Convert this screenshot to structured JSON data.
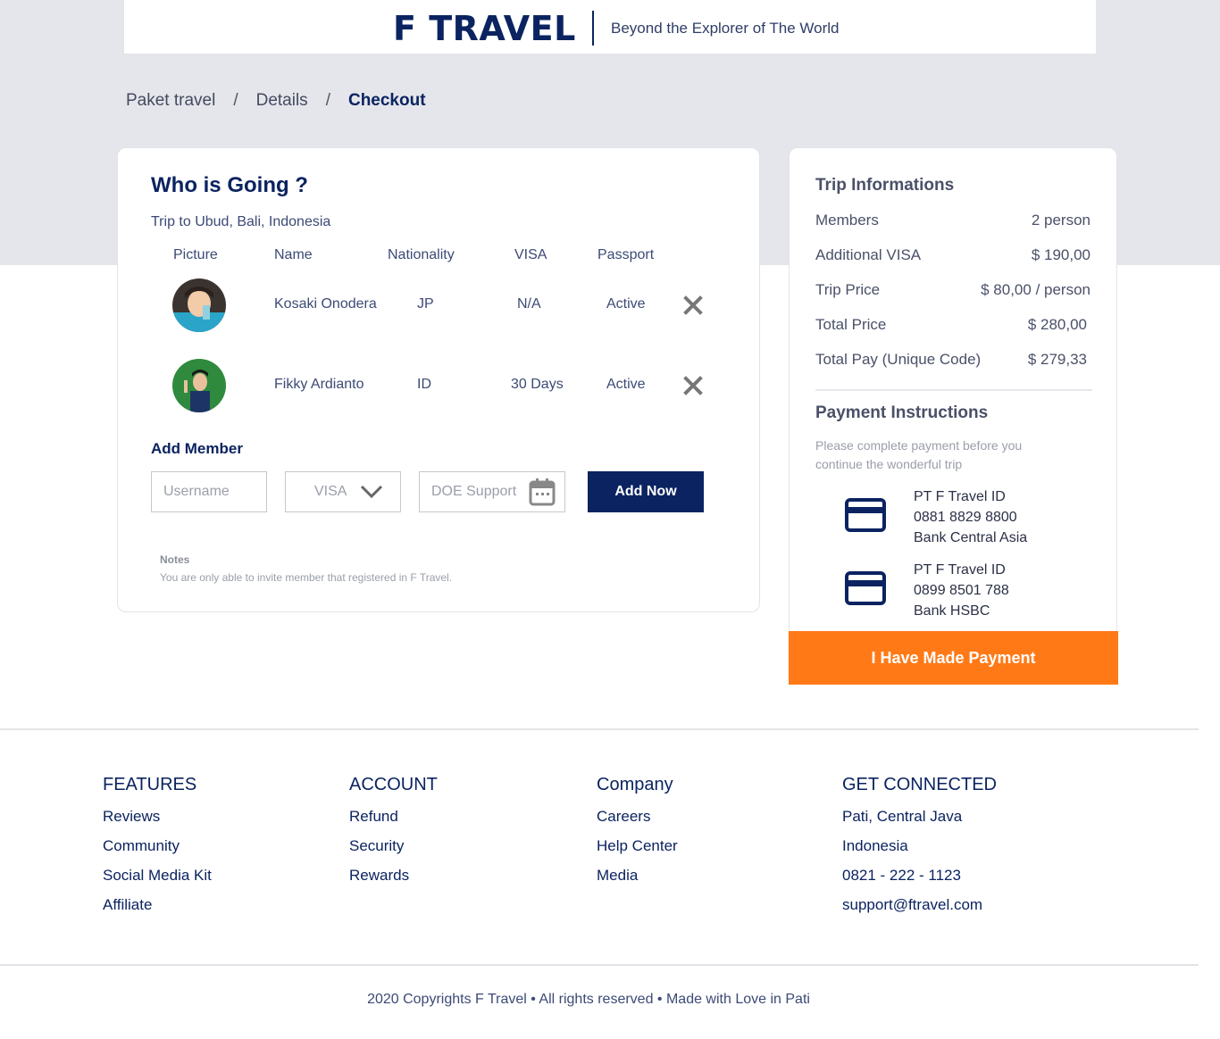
{
  "header": {
    "brand": "F TRAVEL",
    "tagline": "Beyond the Explorer of The World"
  },
  "breadcrumb": [
    {
      "label": "Paket travel"
    },
    {
      "label": "Details"
    },
    {
      "label": "Checkout"
    }
  ],
  "members_card": {
    "title": "Who is Going ?",
    "subtitle": "Trip to Ubud, Bali, Indonesia",
    "columns": [
      "Picture",
      "Name",
      "Nationality",
      "VISA",
      "Passport"
    ],
    "rows": [
      {
        "name": "Kosaki Onodera",
        "nationality": "JP",
        "visa": "N/A",
        "passport": "Active"
      },
      {
        "name": "Fikky Ardianto",
        "nationality": "ID",
        "visa": "30 Days",
        "passport": "Active"
      }
    ],
    "add_member_title": "Add Member",
    "username_placeholder": "Username",
    "visa_select": "VISA",
    "doe_placeholder": "DOE Support",
    "add_button": "Add Now",
    "notes_title": "Notes",
    "notes_text": "You are only able to invite member that registered in F Travel."
  },
  "trip_info": {
    "title": "Trip Informations",
    "rows": [
      {
        "label": "Members",
        "value": "2 person"
      },
      {
        "label": "Additional VISA",
        "value": "$ 190,00"
      },
      {
        "label": "Trip Price",
        "value": "$ 80,00 / person"
      },
      {
        "label": "Total Price",
        "value": "$ 280,00"
      },
      {
        "label": "Total Pay (Unique Code)",
        "value": "$ 279,33"
      }
    ],
    "payment_title": "Payment Instructions",
    "payment_desc": "Please complete payment before you continue the wonderful trip",
    "banks": [
      {
        "name": "PT F Travel ID",
        "account": "0881 8829 8800",
        "bank": "Bank Central Asia"
      },
      {
        "name": "PT F Travel ID",
        "account": "0899 8501 788",
        "bank": "Bank HSBC"
      }
    ],
    "pay_button": "I Have Made Payment"
  },
  "footer": {
    "columns": [
      {
        "title": "FEATURES",
        "links": [
          "Reviews",
          "Community",
          "Social Media Kit",
          "Affiliate"
        ]
      },
      {
        "title": "ACCOUNT",
        "links": [
          "Refund",
          "Security",
          "Rewards"
        ]
      },
      {
        "title": "Company",
        "links": [
          "Careers",
          "Help Center",
          "Media"
        ]
      },
      {
        "title": "GET CONNECTED",
        "links": [
          "Pati, Central Java",
          "Indonesia",
          "0821 - 222 - 1123",
          "support@ftravel.com"
        ]
      }
    ],
    "copyright": "2020 Copyrights F Travel • All rights reserved • Made with Love in Pati"
  },
  "colors": {
    "primary": "#0b2360",
    "accent": "#ff7a17",
    "band": "#e5e6eb"
  }
}
